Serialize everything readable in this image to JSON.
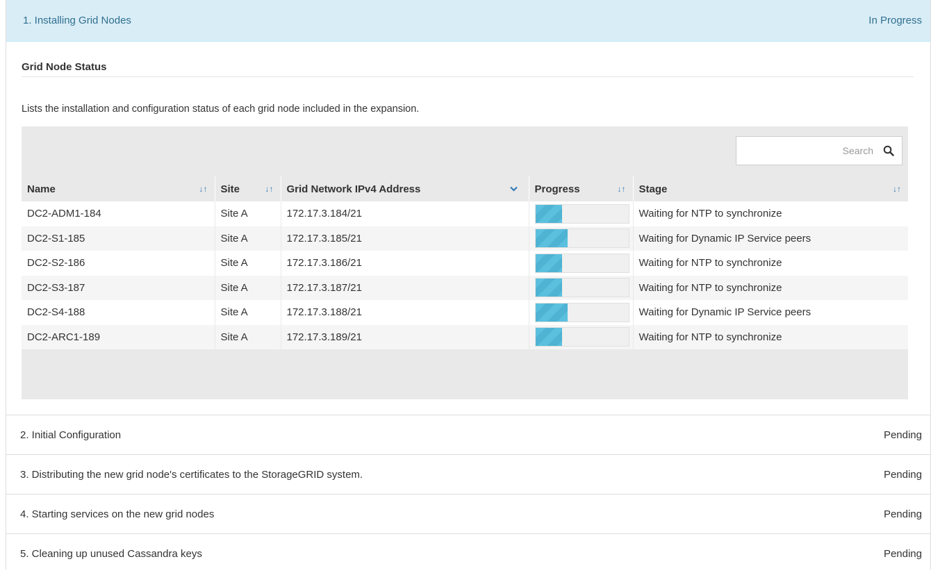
{
  "steps": [
    {
      "label": "1. Installing Grid Nodes",
      "status": "In Progress"
    },
    {
      "label": "2. Initial Configuration",
      "status": "Pending"
    },
    {
      "label": "3. Distributing the new grid node's certificates to the StorageGRID system.",
      "status": "Pending"
    },
    {
      "label": "4. Starting services on the new grid nodes",
      "status": "Pending"
    },
    {
      "label": "5. Cleaning up unused Cassandra keys",
      "status": "Pending"
    }
  ],
  "grid_node_status": {
    "title": "Grid Node Status",
    "description": "Lists the installation and configuration status of each grid node included in the expansion.",
    "search_placeholder": "Search",
    "columns": [
      "Name",
      "Site",
      "Grid Network IPv4 Address",
      "Progress",
      "Stage"
    ],
    "rows": [
      {
        "name": "DC2-ADM1-184",
        "site": "Site A",
        "ip": "172.17.3.184/21",
        "progress": 0.29,
        "stage": "Waiting for NTP to synchronize"
      },
      {
        "name": "DC2-S1-185",
        "site": "Site A",
        "ip": "172.17.3.185/21",
        "progress": 0.35,
        "stage": "Waiting for Dynamic IP Service peers"
      },
      {
        "name": "DC2-S2-186",
        "site": "Site A",
        "ip": "172.17.3.186/21",
        "progress": 0.29,
        "stage": "Waiting for NTP to synchronize"
      },
      {
        "name": "DC2-S3-187",
        "site": "Site A",
        "ip": "172.17.3.187/21",
        "progress": 0.29,
        "stage": "Waiting for NTP to synchronize"
      },
      {
        "name": "DC2-S4-188",
        "site": "Site A",
        "ip": "172.17.3.188/21",
        "progress": 0.35,
        "stage": "Waiting for Dynamic IP Service peers"
      },
      {
        "name": "DC2-ARC1-189",
        "site": "Site A",
        "ip": "172.17.3.189/21",
        "progress": 0.29,
        "stage": "Waiting for NTP to synchronize"
      }
    ]
  },
  "icons": {
    "sort": "sort-icon",
    "sort_desc": "chevron-down-icon",
    "search": "search-icon"
  },
  "colors": {
    "active_step_bg": "#d9edf7",
    "active_step_text": "#31708f",
    "progress_fill": "#5bc0de",
    "sort_icon": "#337ab7"
  }
}
